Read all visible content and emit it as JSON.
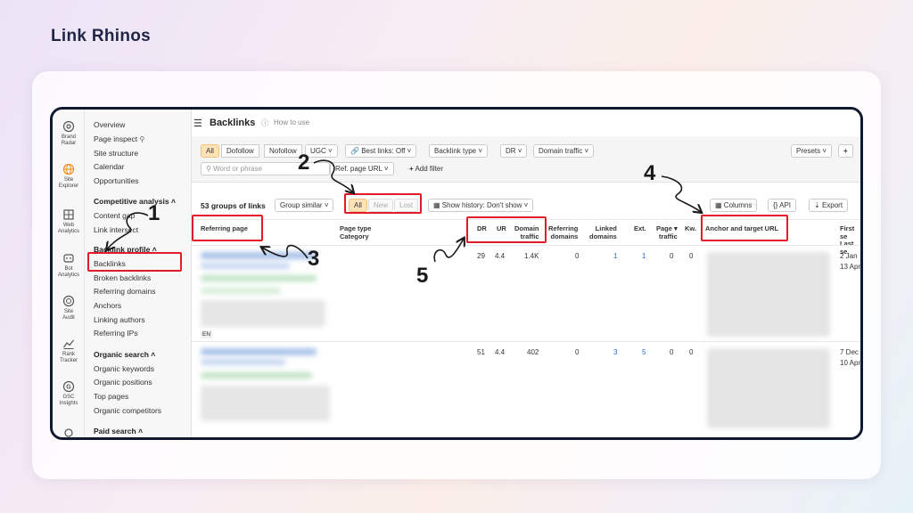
{
  "brand": "Link Rhinos",
  "iconbar": [
    {
      "label_1": "Brand",
      "label_2": "Radar",
      "icon": "radar-icon"
    },
    {
      "label_1": "Site",
      "label_2": "Explorer",
      "icon": "globe-icon",
      "active": true
    },
    {
      "label_1": "Web",
      "label_2": "Analytics",
      "icon": "bar-chart-icon"
    },
    {
      "label_1": "Bot",
      "label_2": "Analytics",
      "icon": "bot-icon"
    },
    {
      "label_1": "Site",
      "label_2": "Audit",
      "icon": "audit-icon"
    },
    {
      "label_1": "Rank",
      "label_2": "Tracker",
      "icon": "line-chart-icon"
    },
    {
      "label_1": "GSC",
      "label_2": "Insights",
      "icon": "google-icon"
    }
  ],
  "sidebar": {
    "overview": "Overview",
    "page_inspect": "Page inspect",
    "site_structure": "Site structure",
    "calendar": "Calendar",
    "opportunities": "Opportunities",
    "competitive_head": "Competitive analysis",
    "content_gap": "Content gap",
    "link_intersect": "Link intersect",
    "backlink_head": "Backlink profile",
    "backlinks": "Backlinks",
    "broken_backlinks": "Broken backlinks",
    "referring_domains": "Referring domains",
    "anchors": "Anchors",
    "linking_authors": "Linking authors",
    "referring_ips": "Referring IPs",
    "organic_head": "Organic search",
    "organic_keywords": "Organic keywords",
    "organic_positions": "Organic positions",
    "top_pages": "Top pages",
    "organic_competitors": "Organic competitors",
    "paid_head": "Paid search"
  },
  "topbar": {
    "title": "Backlinks",
    "how_to_use": "How to use"
  },
  "filters": {
    "all": "All",
    "dofollow": "Dofollow",
    "nofollow": "Nofollow",
    "ugc": "UGC",
    "best_links": "Best links: Off",
    "backlink_type": "Backlink type",
    "dr": "DR",
    "domain_traffic": "Domain traffic",
    "presets": "Presets",
    "plus": "+",
    "search_placeholder": "Word or phrase",
    "ref_page_url": "Ref. page URL",
    "add_filter": "Add filter"
  },
  "toolbar": {
    "groups": "53 groups of links",
    "group_similar": "Group similar",
    "seg_all": "All",
    "seg_new": "New",
    "seg_lost": "Lost",
    "history": "Show history: Don't show",
    "columns": "Columns",
    "api": "API",
    "export": "Export"
  },
  "columns": {
    "referring_page": "Referring page",
    "page_type": "Page type",
    "category": "Category",
    "dr": "DR",
    "ur": "UR",
    "domain": "Domain",
    "traffic": "traffic",
    "referring": "Referring",
    "domains": "domains",
    "linked": "Linked",
    "linked_domains": "domains",
    "ext": "Ext.",
    "page": "Page",
    "page_traffic": "traffic",
    "kw": "Kw.",
    "anchor": "Anchor and target URL",
    "first_seen": "First se",
    "last_seen": "Last se"
  },
  "rows": [
    {
      "dr": "29",
      "ur": "4.4",
      "traffic": "1.4K",
      "ref_domains": "0",
      "linked": "1",
      "ext": "1",
      "page_traffic": "0",
      "kw": "0",
      "first": "2 Jan",
      "last": "13 Apr",
      "lang": "EN"
    },
    {
      "dr": "51",
      "ur": "4.4",
      "traffic": "402",
      "ref_domains": "0",
      "linked": "3",
      "ext": "5",
      "page_traffic": "0",
      "kw": "0",
      "first": "7 Dec",
      "last": "10 Apr"
    }
  ],
  "annotations": {
    "n1": "1",
    "n2": "2",
    "n3": "3",
    "n4": "4",
    "n5": "5"
  },
  "colors": {
    "accent": "#f08c1a",
    "highlight_red": "#e11b2a",
    "link_blue": "#2b6cd6"
  }
}
